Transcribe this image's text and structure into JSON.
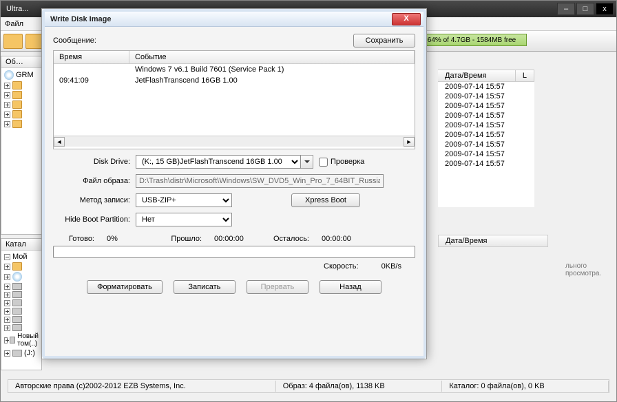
{
  "parent": {
    "title": "Ultra...",
    "menu_file": "Файл",
    "disk_usage": "64% of 4.7GB - 1584MB free",
    "left_hdr1": "Об…",
    "left_grm": "GRM",
    "left_hdr2": "Катал",
    "left_mycomp": "Мой",
    "novy": "Новый том(..)",
    "drive_j": "(J:)"
  },
  "filelist": {
    "col_datetime": "Дата/Время",
    "col_l": "L",
    "rows": [
      "2009-07-14 15:57",
      "2009-07-14 15:57",
      "2009-07-14 15:57",
      "2009-07-14 15:57",
      "2009-07-14 15:57",
      "2009-07-14 15:57",
      "2009-07-14 15:57",
      "2009-07-14 15:57",
      "2009-07-14 15:57"
    ],
    "lower_col": "Дата/Время",
    "preview": "льного просмотра."
  },
  "status": {
    "copyright": "Авторские права (c)2002-2012 EZB Systems, Inc.",
    "obraz": "Образ: 4 файла(ов), 1138 KB",
    "katalog": "Каталог: 0 файла(ов), 0 KB"
  },
  "dialog": {
    "title": "Write Disk Image",
    "message_label": "Сообщение:",
    "save_btn": "Сохранить",
    "col_time": "Время",
    "col_event": "Событие",
    "log": [
      {
        "time": "",
        "event": "Windows 7 v6.1 Build 7601 (Service Pack 1)"
      },
      {
        "time": "09:41:09",
        "event": "JetFlashTranscend 16GB  1.00"
      }
    ],
    "disk_drive_label": "Disk Drive:",
    "disk_drive_value": "(K:, 15 GB)JetFlashTranscend 16GB  1.00",
    "check_label": "Проверка",
    "image_file_label": "Файл образа:",
    "image_file_value": "D:\\Trash\\distr\\Microsoft\\Windows\\SW_DVD5_Win_Pro_7_64BIT_Russia",
    "write_method_label": "Метод записи:",
    "write_method_value": "USB-ZIP+",
    "xpress_boot": "Xpress Boot",
    "hide_boot_label": "Hide Boot Partition:",
    "hide_boot_value": "Нет",
    "ready_label": "Готово:",
    "ready_value": "0%",
    "elapsed_label": "Прошло:",
    "elapsed_value": "00:00:00",
    "remaining_label": "Осталось:",
    "remaining_value": "00:00:00",
    "speed_label": "Скорость:",
    "speed_value": "0KB/s",
    "btn_format": "Форматировать",
    "btn_write": "Записать",
    "btn_abort": "Прервать",
    "btn_back": "Назад"
  }
}
